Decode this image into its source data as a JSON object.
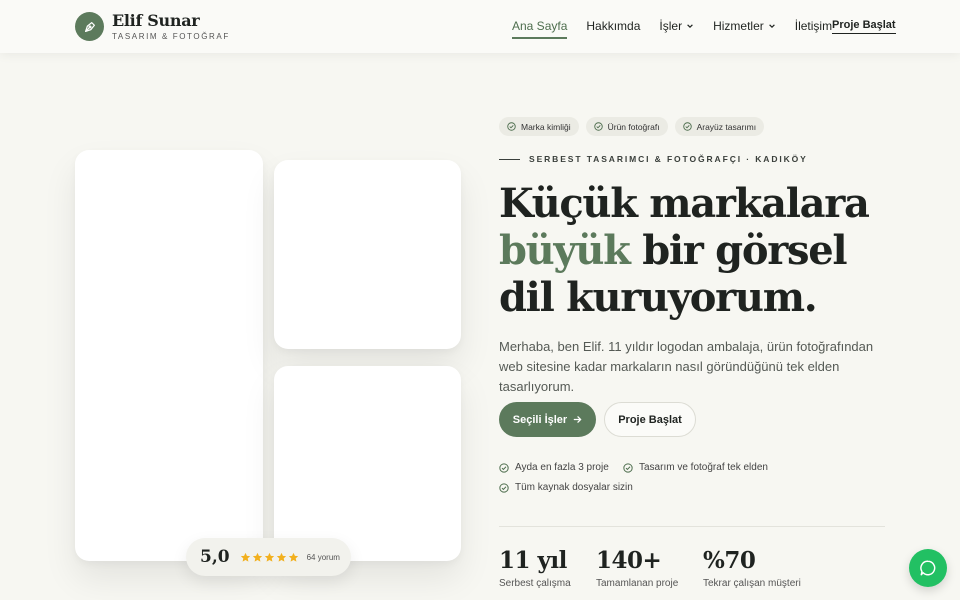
{
  "brand": {
    "name": "Elif Sunar",
    "subtitle": "TASARIM & FOTOĞRAF",
    "logo_icon": "pen-nib-icon",
    "color": "#5c7a5c"
  },
  "nav": {
    "items": [
      {
        "label": "Ana Sayfa",
        "active": true
      },
      {
        "label": "Hakkımda"
      },
      {
        "label": "İşler",
        "dropdown": true
      },
      {
        "label": "Hizmetler",
        "dropdown": true
      },
      {
        "label": "İletişim"
      }
    ],
    "cta": "Proje Başlat"
  },
  "hero": {
    "tags": [
      "Marka kimliği",
      "Ürün fotoğrafı",
      "Arayüz tasarımı"
    ],
    "eyebrow": "SERBEST TASARIMCI & FOTOĞRAFÇI · KADIKÖY",
    "headline": {
      "line1": "Küçük markalara",
      "accent": "büyük",
      "line2_rest": " bir görsel",
      "line3": "dil kuruyorum."
    },
    "lead": "Merhaba, ben Elif. 11 yıldır logodan ambalaja, ürün fotoğrafından web sitesine kadar markaların nasıl göründüğünü tek elden tasarlıyorum.",
    "primary_button": "Seçili İşler",
    "secondary_button": "Proje Başlat",
    "features": [
      "Ayda en fazla 3 proje",
      "Tasarım ve fotoğraf tek elden",
      "Tüm kaynak dosyalar sizin"
    ]
  },
  "stats": [
    {
      "value": "11 yıl",
      "label": "Serbest çalışma"
    },
    {
      "value": "140+",
      "label": "Tamamlanan proje"
    },
    {
      "value": "%70",
      "label": "Tekrar çalışan müşteri"
    }
  ],
  "rating": {
    "score": "5,0",
    "stars": 5,
    "count": "64 yorum",
    "star_color": "#f2b01e"
  },
  "chat": {
    "icon": "chat-bubble-icon",
    "color": "#22c063"
  },
  "colors": {
    "accent": "#5c7a5c",
    "background": "#f7f7f2"
  }
}
